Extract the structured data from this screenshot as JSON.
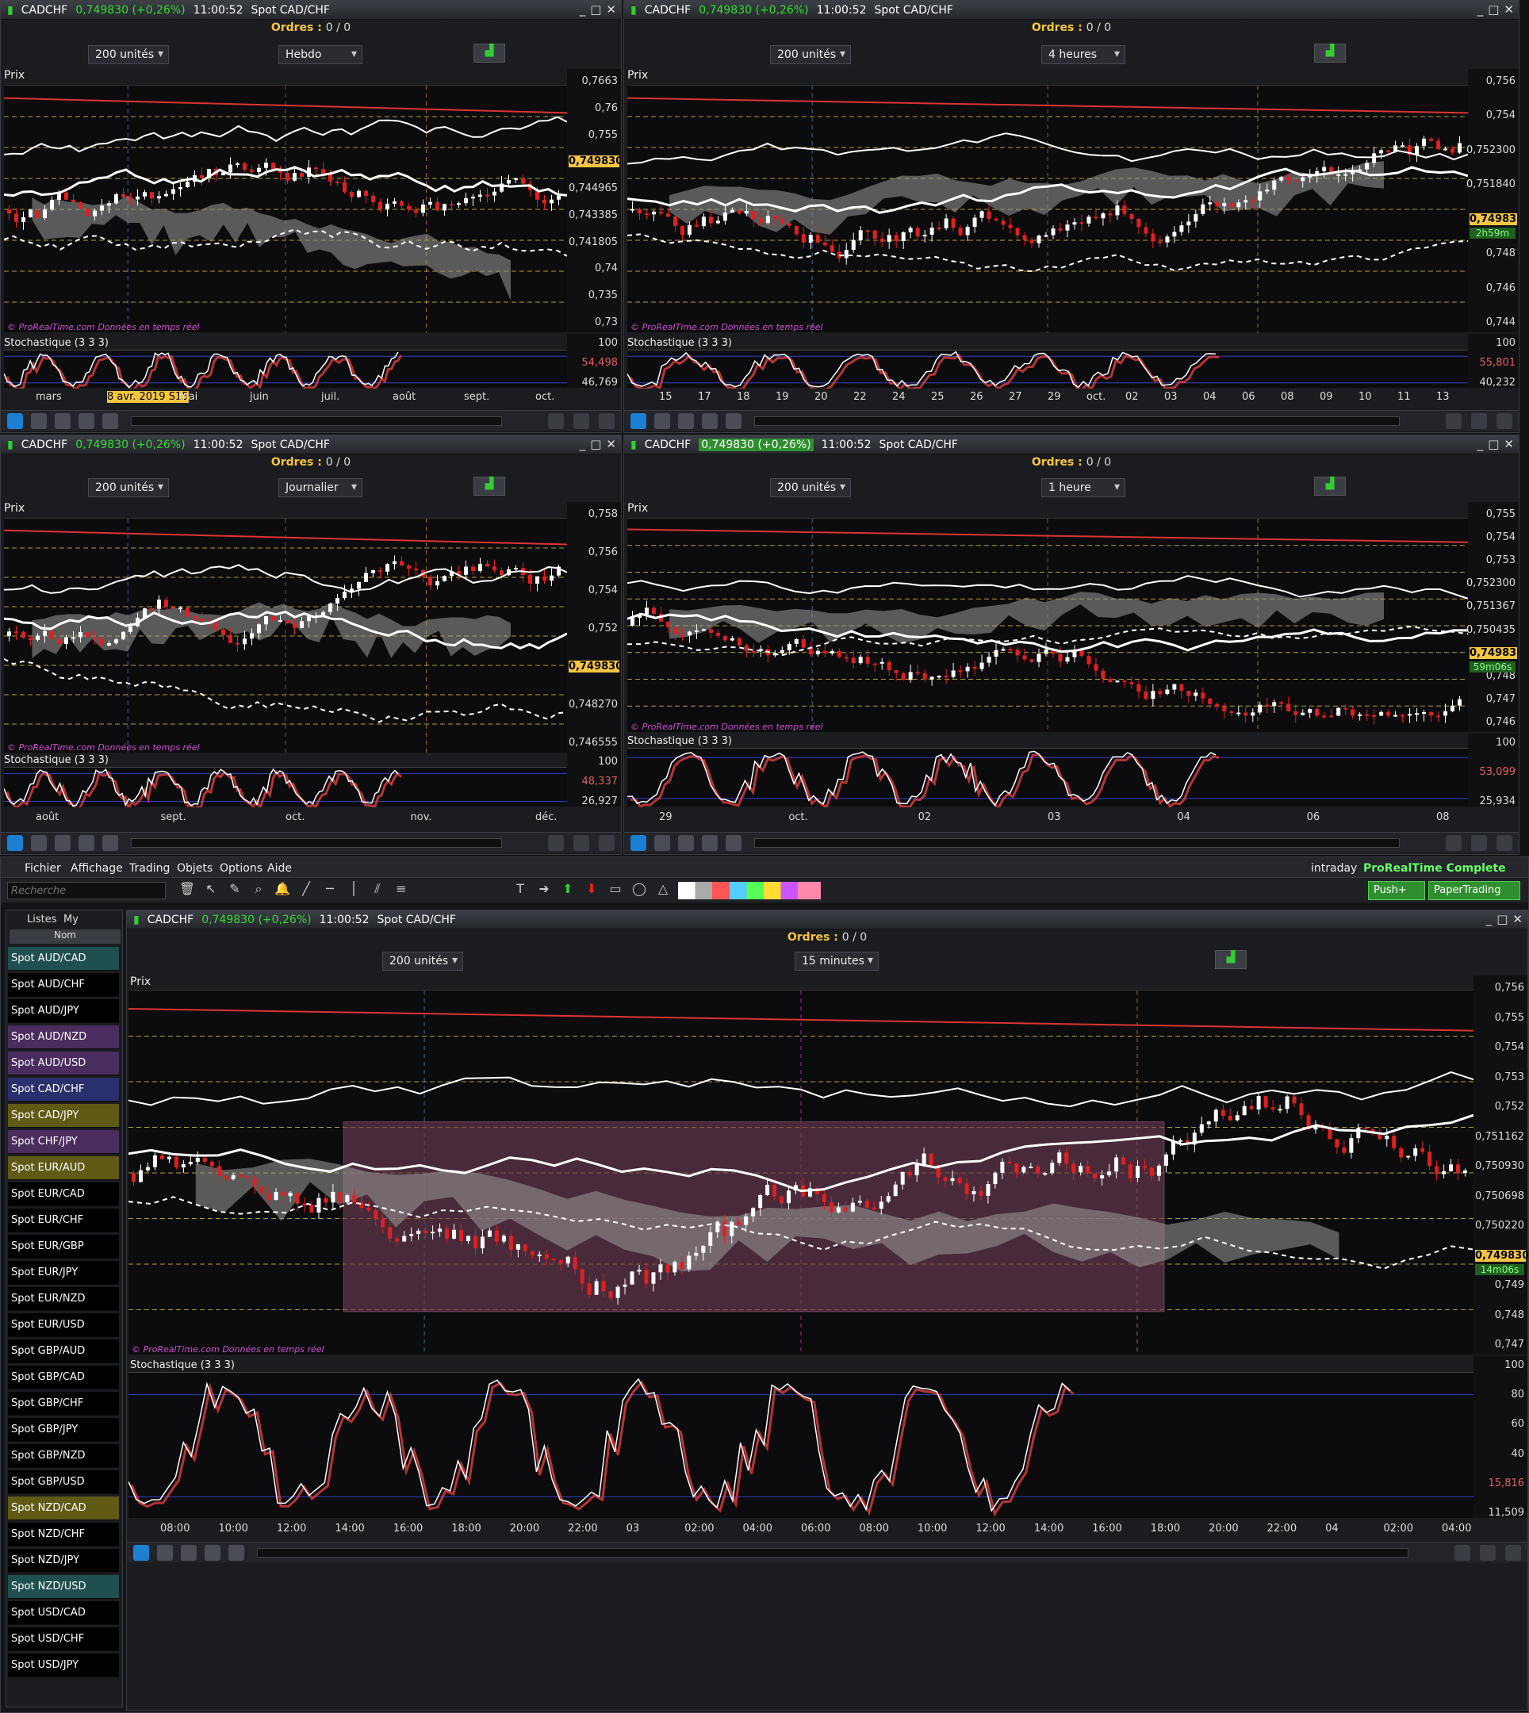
{
  "symbol": "CADCHF",
  "quote": "0,749830 (+0,26%)",
  "time": "11:00:52",
  "instrument": "Spot CAD/CHF",
  "orders_label": "Ordres : ",
  "orders_value": "0",
  "orders_value2": "/ 0",
  "units": "200 unités",
  "price_label": "Prix",
  "stoch_label": "Stochastique (3 3 3)",
  "copyright": "© ProRealTime.com  Données en temps réel",
  "current_price": "0,749830",
  "charts": [
    {
      "period": "Hebdo",
      "scale": [
        "0,7663",
        "0,76",
        "0,755",
        "0,749830",
        "0,744965",
        "0,743385",
        "0,741805",
        "0,74",
        "0,735",
        "0,73"
      ],
      "stoch": [
        "100",
        "54,498",
        "46,769"
      ],
      "xaxis": [
        "mars",
        "8 avr. 2019 S15",
        "mai",
        "juin",
        "juil.",
        "août",
        "sept.",
        "oct."
      ],
      "countdown": ""
    },
    {
      "period": "4 heures",
      "scale": [
        "0,756",
        "0,754",
        "0,752300",
        "0,751840",
        "0,749830",
        "0,748",
        "0,746",
        "0,744"
      ],
      "stoch": [
        "100",
        "55,801",
        "40,232"
      ],
      "xaxis": [
        "15",
        "17",
        "18",
        "19",
        "20",
        "22",
        "24",
        "25",
        "26",
        "27",
        "29",
        "oct.",
        "02",
        "03",
        "04",
        "06",
        "08",
        "09",
        "10",
        "11",
        "13"
      ],
      "countdown": "2h59m"
    },
    {
      "period": "Journalier",
      "scale": [
        "0,758",
        "0,756",
        "0,754",
        "0,752",
        "0,749830",
        "0,748270",
        "0,746555"
      ],
      "stoch": [
        "100",
        "48,337",
        "26,927"
      ],
      "xaxis": [
        "août",
        "sept.",
        "oct.",
        "nov.",
        "déc."
      ],
      "countdown": ""
    },
    {
      "period": "1 heure",
      "scale": [
        "0,755",
        "0,754",
        "0,753",
        "0,752300",
        "0,751367",
        "0,750435",
        "0,749830",
        "0,748",
        "0,747",
        "0,746"
      ],
      "stoch": [
        "100",
        "53,099",
        "25,934"
      ],
      "xaxis": [
        "29",
        "oct.",
        "02",
        "03",
        "04",
        "06",
        "08"
      ],
      "countdown": "59m06s"
    },
    {
      "period": "15 minutes",
      "scale": [
        "0,756",
        "0,755",
        "0,754",
        "0,753",
        "0,752",
        "0,751162",
        "0,750930",
        "0,750698",
        "0,750220",
        "0,749830",
        "0,749",
        "0,748",
        "0,747"
      ],
      "stoch": [
        "100",
        "80",
        "60",
        "40",
        "15,816",
        "11,509"
      ],
      "xaxis": [
        "08:00",
        "10:00",
        "12:00",
        "14:00",
        "16:00",
        "18:00",
        "20:00",
        "22:00",
        "03",
        "02:00",
        "04:00",
        "06:00",
        "08:00",
        "10:00",
        "12:00",
        "14:00",
        "16:00",
        "18:00",
        "20:00",
        "22:00",
        "04",
        "02:00",
        "04:00"
      ],
      "countdown": "14m06s"
    }
  ],
  "menu": [
    "Fichier",
    "Affichage",
    "Trading",
    "Objets",
    "Options",
    "Aide"
  ],
  "mode": "intraday",
  "brand": "ProRealTime Complete",
  "push_btn": "Push+",
  "paper_btn": "PaperTrading",
  "search_placeholder": "Recherche",
  "tabs": [
    "Listes",
    "My"
  ],
  "col_header": "Nom",
  "watchlist": [
    {
      "name": "Spot AUD/CAD",
      "bg": "#1f4f4f"
    },
    {
      "name": "Spot AUD/CHF",
      "bg": "#000000"
    },
    {
      "name": "Spot AUD/JPY",
      "bg": "#000000"
    },
    {
      "name": "Spot AUD/NZD",
      "bg": "#4a2d5e"
    },
    {
      "name": "Spot AUD/USD",
      "bg": "#4a2d5e"
    },
    {
      "name": "Spot CAD/CHF",
      "bg": "#2a2f6e"
    },
    {
      "name": "Spot CAD/JPY",
      "bg": "#5f5a16"
    },
    {
      "name": "Spot CHF/JPY",
      "bg": "#4a2d5e"
    },
    {
      "name": "Spot EUR/AUD",
      "bg": "#5f5a16"
    },
    {
      "name": "Spot EUR/CAD",
      "bg": "#000000"
    },
    {
      "name": "Spot EUR/CHF",
      "bg": "#000000"
    },
    {
      "name": "Spot EUR/GBP",
      "bg": "#000000"
    },
    {
      "name": "Spot EUR/JPY",
      "bg": "#000000"
    },
    {
      "name": "Spot EUR/NZD",
      "bg": "#000000"
    },
    {
      "name": "Spot EUR/USD",
      "bg": "#000000"
    },
    {
      "name": "Spot GBP/AUD",
      "bg": "#000000"
    },
    {
      "name": "Spot GBP/CAD",
      "bg": "#000000"
    },
    {
      "name": "Spot GBP/CHF",
      "bg": "#000000"
    },
    {
      "name": "Spot GBP/JPY",
      "bg": "#000000"
    },
    {
      "name": "Spot GBP/NZD",
      "bg": "#000000"
    },
    {
      "name": "Spot GBP/USD",
      "bg": "#000000"
    },
    {
      "name": "Spot NZD/CAD",
      "bg": "#5f5a16"
    },
    {
      "name": "Spot NZD/CHF",
      "bg": "#000000"
    },
    {
      "name": "Spot NZD/JPY",
      "bg": "#000000"
    },
    {
      "name": "Spot NZD/USD",
      "bg": "#1f4f4f"
    },
    {
      "name": "Spot USD/CAD",
      "bg": "#000000"
    },
    {
      "name": "Spot USD/CHF",
      "bg": "#000000"
    },
    {
      "name": "Spot USD/JPY",
      "bg": "#000000"
    }
  ],
  "colors": {
    "bull": "#ffffff",
    "bear": "#e02020",
    "cloud": "#9a9a9a",
    "level": "#d7c83a",
    "accent": "#f5c542",
    "zone": "#6b3a52"
  }
}
